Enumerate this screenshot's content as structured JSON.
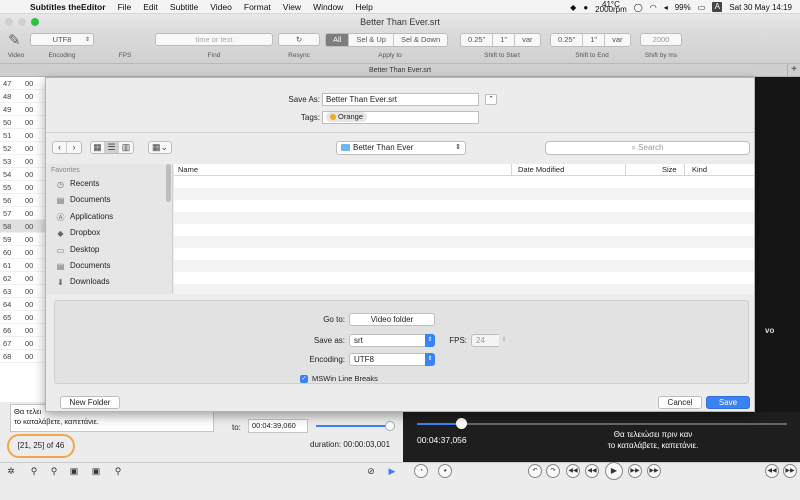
{
  "menubar": {
    "app_name": "Subtitles theEditor",
    "items": [
      "File",
      "Edit",
      "Subtitle",
      "Video",
      "Format",
      "View",
      "Window",
      "Help"
    ],
    "temp": "41°C",
    "rpm": "2000rpm",
    "battery": "99%",
    "input_source": "A",
    "clock": "Sat 30 May  14:19"
  },
  "window": {
    "title": "Better Than Ever.srt",
    "doc_tab": "Better Than Ever.srt"
  },
  "toolbar": {
    "encoding_value": "UTF8",
    "labels": {
      "video": "Video",
      "encoding": "Encoding",
      "fps": "FPS",
      "find": "Find",
      "resync": "Resync",
      "apply_to": "Apply to",
      "shift_start": "Shift to Start",
      "shift_end": "Shift to End",
      "shift_ms": "Shift by ms"
    },
    "find_placeholder": "time or text",
    "apply_segments": [
      "All",
      "Sel & Up",
      "Sel & Down"
    ],
    "shift_start": [
      "0.25\"",
      "1\"",
      "var"
    ],
    "shift_end": [
      "0.25\"",
      "1\"",
      "var"
    ],
    "shift_ms_value": "2000"
  },
  "rows": [
    {
      "n": "47",
      "t": "00"
    },
    {
      "n": "48",
      "t": "00"
    },
    {
      "n": "49",
      "t": "00"
    },
    {
      "n": "50",
      "t": "00"
    },
    {
      "n": "51",
      "t": "00"
    },
    {
      "n": "52",
      "t": "00"
    },
    {
      "n": "53",
      "t": "00"
    },
    {
      "n": "54",
      "t": "00"
    },
    {
      "n": "55",
      "t": "00"
    },
    {
      "n": "56",
      "t": "00"
    },
    {
      "n": "57",
      "t": "00"
    },
    {
      "n": "58",
      "t": "00"
    },
    {
      "n": "59",
      "t": "00"
    },
    {
      "n": "60",
      "t": "00"
    },
    {
      "n": "61",
      "t": "00"
    },
    {
      "n": "62",
      "t": "00"
    },
    {
      "n": "63",
      "t": "00"
    },
    {
      "n": "64",
      "t": "00"
    },
    {
      "n": "65",
      "t": "00"
    },
    {
      "n": "66",
      "t": "00"
    },
    {
      "n": "67",
      "t": "00"
    },
    {
      "n": "68",
      "t": "00"
    }
  ],
  "dialog": {
    "save_as_label": "Save As:",
    "save_as_value": "Better Than Ever.srt",
    "tags_label": "Tags:",
    "tag_value": "Orange",
    "location": "Better Than Ever",
    "search_placeholder": "Search",
    "sidebar_header": "Favorites",
    "sidebar_items": [
      {
        "label": "Recents",
        "icon": "clock-icon"
      },
      {
        "label": "Documents",
        "icon": "document-icon"
      },
      {
        "label": "Applications",
        "icon": "applications-icon"
      },
      {
        "label": "Dropbox",
        "icon": "dropbox-icon"
      },
      {
        "label": "Desktop",
        "icon": "desktop-icon"
      },
      {
        "label": "Documents",
        "icon": "document-icon"
      },
      {
        "label": "Downloads",
        "icon": "download-icon"
      }
    ],
    "columns": {
      "name": "Name",
      "date": "Date Modified",
      "size": "Size",
      "kind": "Kind"
    },
    "goto_label": "Go to:",
    "goto_button": "Video folder",
    "saveas_type_label": "Save as:",
    "saveas_type_value": "srt",
    "fps_label": "FPS:",
    "fps_value": "24",
    "encoding_label": "Encoding:",
    "encoding_value": "UTF8",
    "linebreaks_label": "MSWin Line Breaks",
    "new_folder": "New Folder",
    "cancel": "Cancel",
    "save": "Save"
  },
  "editor": {
    "subtitle_text_1": "Θα τελει",
    "subtitle_text_2": "το καταλάβετε, καπετάνιε.",
    "range_text": "[21, 25] of 46",
    "to_label": "to:",
    "to_value": "00:04:39,060",
    "duration": "duration: 00:00:03,001"
  },
  "player": {
    "time": "00:04:37,056",
    "subtitle_1": "Θα τελειώσει πριν καν",
    "subtitle_2": "το καταλάβετε, καπετάνιε.",
    "video_text": "vo",
    "progress": 0.12
  }
}
